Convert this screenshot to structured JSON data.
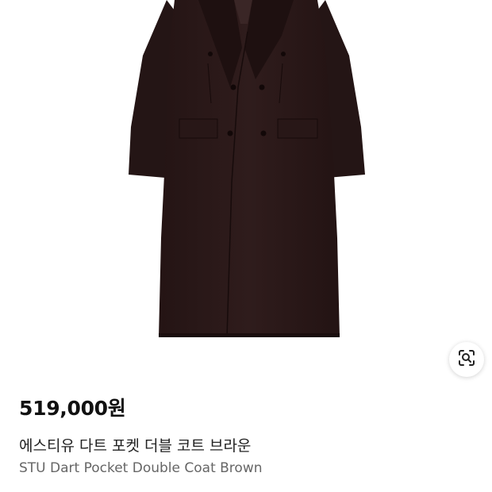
{
  "product": {
    "image_icon": "coat-image",
    "lens_icon": "visual-search-lens-icon",
    "price": "519,000원",
    "title_ko": "에스티유 다트 포켓 더블 코트 브라운",
    "title_en": "STU Dart Pocket Double Coat Brown"
  },
  "colors": {
    "coat": "#2c1a1a",
    "background": "#ffffff",
    "price_text": "#111111",
    "title_text": "#222222",
    "subtitle_text": "#666666"
  }
}
